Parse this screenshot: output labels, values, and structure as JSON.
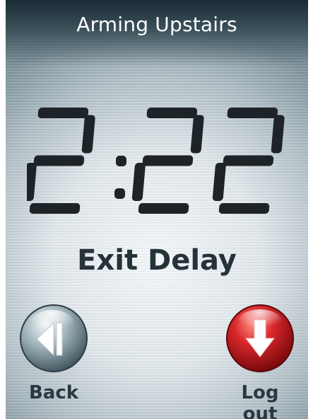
{
  "header": {
    "title": "Arming Upstairs"
  },
  "timer": {
    "display": "2:22"
  },
  "status": {
    "label": "Exit Delay"
  },
  "nav": {
    "back_label": "Back",
    "logout_label": "Log out"
  },
  "colors": {
    "digit": "#1e2328",
    "back_orb": "#6f868f",
    "logout_orb": "#c0161b"
  },
  "icons": {
    "back": "back-arrow-icon",
    "logout": "logout-arrow-icon"
  }
}
